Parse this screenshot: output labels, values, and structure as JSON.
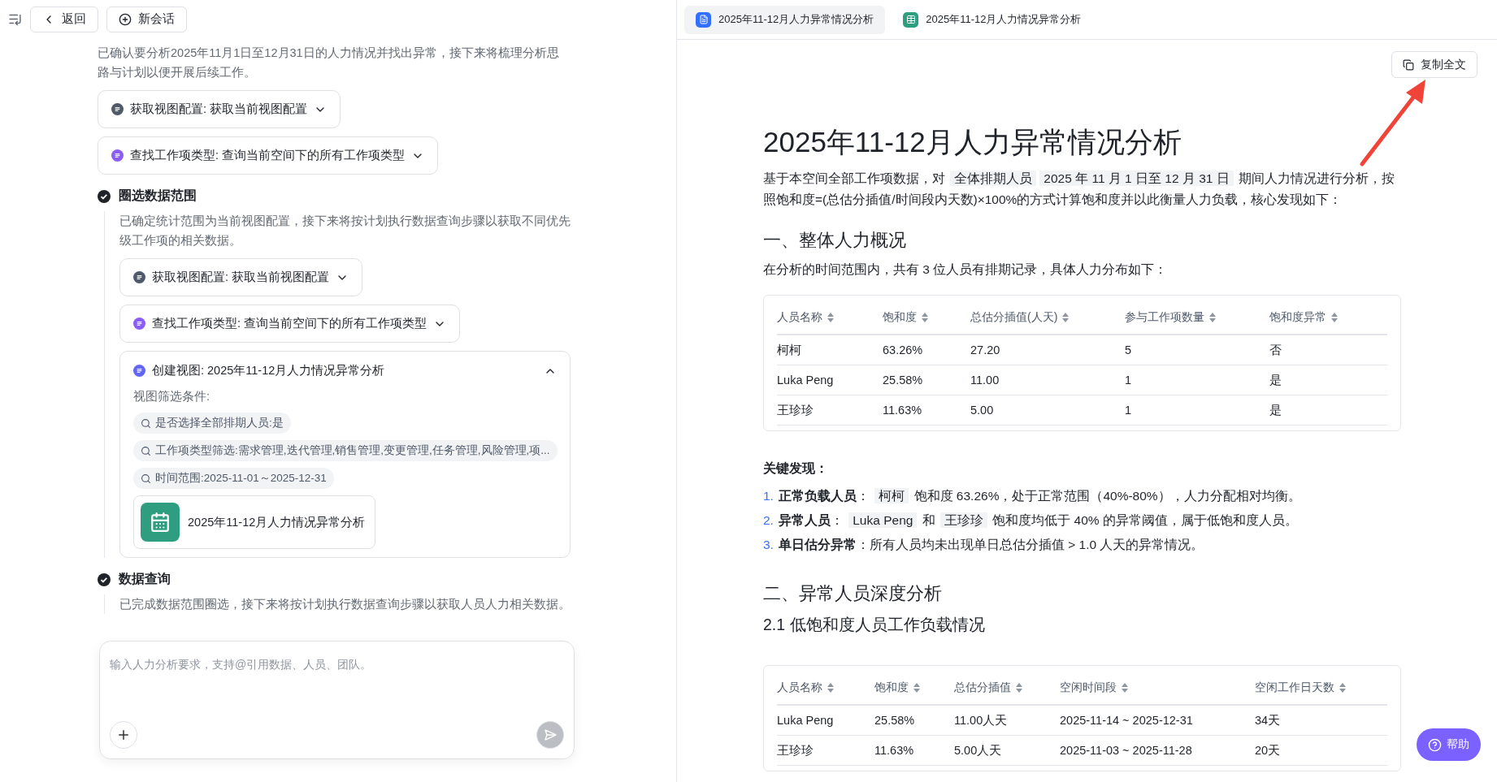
{
  "toolbar": {
    "back": "返回",
    "new_chat": "新会话"
  },
  "intro_text": "已确认要分析2025年11月1日至12月31日的人力情况并找出异常，接下来将梳理分析思路与计划以便开展后续工作。",
  "intro_tools": [
    {
      "kind": "config",
      "label": "获取视图配置: 获取当前视图配置",
      "expanded": false
    },
    {
      "kind": "search",
      "label": "查找工作项类型: 查询当前空间下的所有工作项类型",
      "expanded": false
    }
  ],
  "steps": [
    {
      "title": "圈选数据范围",
      "done": true,
      "text": "已确定统计范围为当前视图配置，接下来将按计划执行数据查询步骤以获取不同优先级工作项的相关数据。",
      "tools": [
        {
          "kind": "config",
          "label": "获取视图配置: 获取当前视图配置",
          "expanded": false
        },
        {
          "kind": "search",
          "label": "查找工作项类型: 查询当前空间下的所有工作项类型",
          "expanded": false
        },
        {
          "kind": "view",
          "label": "创建视图: 2025年11-12月人力情况异常分析",
          "expanded": true,
          "filter_label": "视图筛选条件:",
          "filters": [
            "是否选择全部排期人员:是",
            "工作项类型筛选:需求管理,迭代管理,销售管理,变更管理,任务管理,风险管理,项...",
            "时间范围:2025-11-01～2025-12-31"
          ],
          "view_card": "2025年11-12月人力情况异常分析"
        }
      ]
    },
    {
      "title": "数据查询",
      "done": true,
      "text": "已完成数据范围圈选，接下来将按计划执行数据查询步骤以获取人员人力相关数据。"
    }
  ],
  "input": {
    "placeholder": "输入人力分析要求，支持@引用数据、人员、团队。"
  },
  "doc_tabs": [
    {
      "kind": "doc",
      "label": "2025年11-12月人力异常情况分析",
      "selected": true
    },
    {
      "kind": "table",
      "label": "2025年11-12月人力情况异常分析",
      "selected": false
    }
  ],
  "copy_button": "复制全文",
  "document": {
    "title": "2025年11-12月人力异常情况分析",
    "intro": [
      {
        "kind": "plain",
        "text": "基于本空间全部工作项数据，对 "
      },
      {
        "kind": "chip",
        "text": "全体排期人员"
      },
      {
        "kind": "chip",
        "text": "2025 年 11 月 1 日至 12 月 31 日"
      },
      {
        "kind": "plain",
        "text": " 期间人力情况进行分析，按照饱和度=(总估分插值/时间段内天数)×100%的方式计算饱和度并以此衡量人力负载，核心发现如下："
      }
    ],
    "section1": {
      "heading": "一、整体人力概况",
      "text": "在分析的时间范围内，共有 3 位人员有排期记录，具体人力分布如下：",
      "table": {
        "columns": [
          "人员名称",
          "饱和度",
          "总估分插值(人天)",
          "参与工作项数量",
          "饱和度异常"
        ],
        "rows": [
          [
            "柯柯",
            "63.26%",
            "27.20",
            "5",
            "否"
          ],
          [
            "Luka Peng",
            "25.58%",
            "11.00",
            "1",
            "是"
          ],
          [
            "王珍珍",
            "11.63%",
            "5.00",
            "1",
            "是"
          ]
        ]
      }
    },
    "findings_title": "关键发现：",
    "findings": [
      {
        "number": "1.",
        "segments": [
          {
            "kind": "bold",
            "text": "正常负载人员"
          },
          {
            "kind": "plain",
            "text": "： "
          },
          {
            "kind": "chip",
            "text": "柯柯"
          },
          {
            "kind": "plain",
            "text": " 饱和度 63.26%，处于正常范围（40%-80%），人力分配相对均衡。"
          }
        ]
      },
      {
        "number": "2.",
        "segments": [
          {
            "kind": "bold",
            "text": "异常人员"
          },
          {
            "kind": "plain",
            "text": "： "
          },
          {
            "kind": "chip",
            "text": "Luka Peng"
          },
          {
            "kind": "plain",
            "text": " 和 "
          },
          {
            "kind": "chip",
            "text": "王珍珍"
          },
          {
            "kind": "plain",
            "text": " 饱和度均低于 40% 的异常阈值，属于低饱和度人员。"
          }
        ]
      },
      {
        "number": "3.",
        "segments": [
          {
            "kind": "bold",
            "text": "单日估分异常"
          },
          {
            "kind": "plain",
            "text": "：所有人员均未出现单日总估分插值 > 1.0 人天的异常情况。"
          }
        ]
      }
    ],
    "section2": {
      "heading": "二、异常人员深度分析",
      "subheading": "2.1 低饱和度人员工作负载情况",
      "table": {
        "columns": [
          "人员名称",
          "饱和度",
          "总估分插值",
          "空闲时间段",
          "空闲工作日天数"
        ],
        "rows": [
          [
            "Luka Peng",
            "25.58%",
            "11.00人天",
            "2025-11-14 ~ 2025-12-31",
            "34天"
          ],
          [
            "王珍珍",
            "11.63%",
            "5.00人天",
            "2025-11-03 ~ 2025-11-28",
            "20天"
          ]
        ]
      }
    }
  },
  "help_button": "帮助"
}
